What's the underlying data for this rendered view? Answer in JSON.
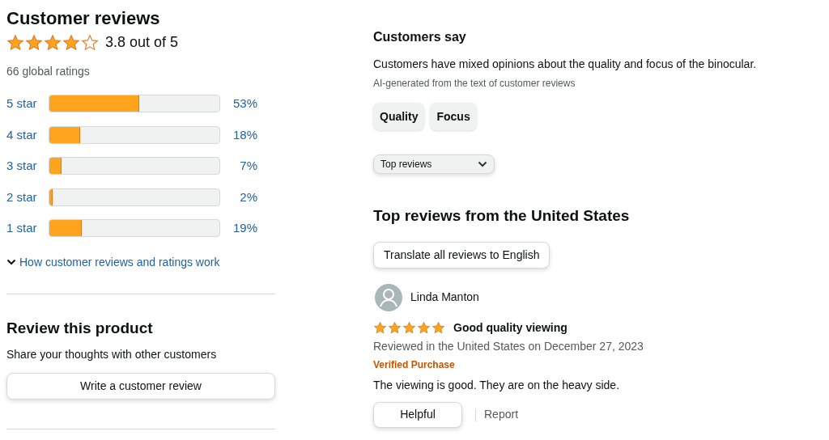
{
  "summary": {
    "title": "Customer reviews",
    "stars": 4,
    "rating_text": "3.8 out of 5",
    "total": "66 global ratings",
    "histogram": [
      {
        "label": "5 star",
        "level": 0.53,
        "percent": "53%"
      },
      {
        "label": "4 star",
        "level": 0.18,
        "percent": "18%"
      },
      {
        "label": "3 star",
        "level": 0.07,
        "percent": "7%"
      },
      {
        "label": "2 star",
        "level": 0.02,
        "percent": "2%"
      },
      {
        "label": "1 star",
        "level": 0.19,
        "percent": "19%"
      }
    ],
    "how_link": "How customer reviews and ratings work"
  },
  "review_product": {
    "title": "Review this product",
    "text": "Share your thoughts with other customers",
    "button": "Write a customer review"
  },
  "customers_say": {
    "title": "Customers say",
    "text": "Customers have mixed opinions about the quality and focus of the binocular.",
    "note": "AI-generated from the text of customer reviews",
    "aspects": [
      {
        "label": "Quality"
      },
      {
        "label": "Focus"
      }
    ]
  },
  "sort": {
    "value": "Top reviews"
  },
  "top_reviews": {
    "title": "Top reviews from the United States",
    "translate_button": "Translate all reviews to English",
    "reviews": [
      {
        "author": "Linda Manton",
        "stars": 5,
        "title": "Good quality viewing",
        "meta": "Reviewed in the United States on December 27, 2023",
        "badge": "Verified Purchase",
        "body": "The viewing is good. They are on the heavy side.",
        "helpful": "Helpful",
        "report": "Report"
      }
    ]
  }
}
